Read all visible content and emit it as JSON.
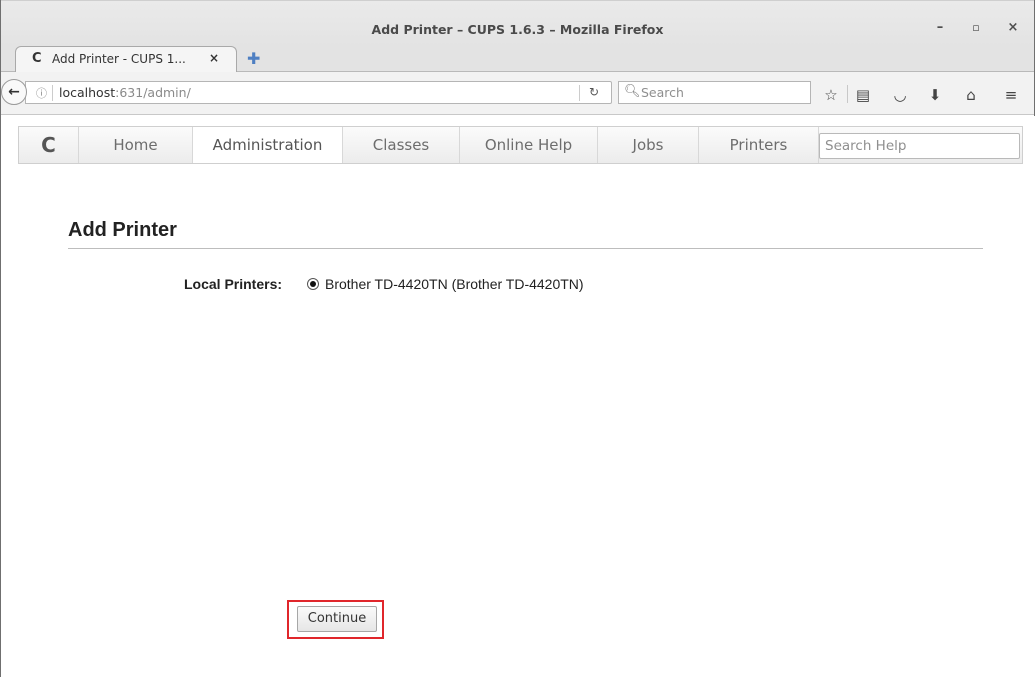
{
  "window": {
    "title": "Add Printer – CUPS 1.6.3 – Mozilla Firefox",
    "minimize_glyph": "–",
    "maximize_glyph": "▫",
    "close_glyph": "×"
  },
  "tab": {
    "title": "Add Printer - CUPS 1...",
    "close_glyph": "×",
    "new_tab_glyph": "✚"
  },
  "navbar": {
    "url_host": "localhost",
    "url_rest": ":631/admin/",
    "search_placeholder": "Search"
  },
  "cups_nav": {
    "items": [
      "Home",
      "Administration",
      "Classes",
      "Online Help",
      "Jobs",
      "Printers"
    ],
    "active": "Administration",
    "search_placeholder": "Search Help"
  },
  "page": {
    "title": "Add Printer",
    "field_label": "Local Printers:",
    "printer_option": "Brother TD-4420TN (Brother TD-4420TN)",
    "continue_label": "Continue"
  },
  "colors": {
    "highlight": "#e0262b"
  },
  "icons": [
    "bookmark-star-icon",
    "reading-list-icon",
    "pocket-icon",
    "download-icon",
    "home-icon",
    "menu-icon"
  ]
}
